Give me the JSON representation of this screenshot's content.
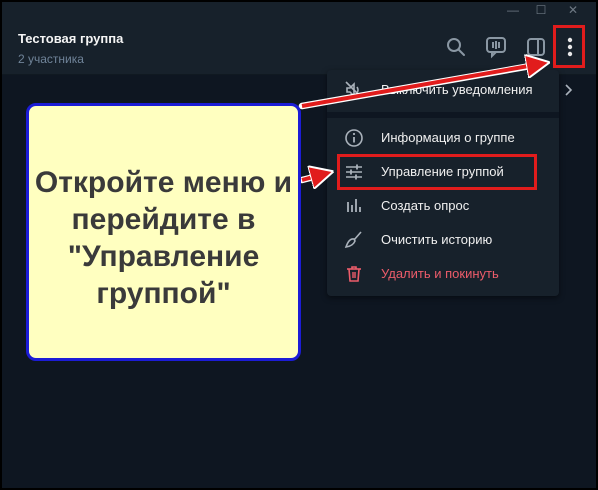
{
  "chat": {
    "title": "Тестовая группа",
    "subtitle": "2 участника"
  },
  "window": {
    "minimize": "—",
    "maximize": "☐",
    "close": "✕"
  },
  "menu": {
    "items": [
      {
        "label": "Выключить уведомления",
        "icon": "mute-icon"
      },
      {
        "label": "Информация о группе",
        "icon": "info-icon"
      },
      {
        "label": "Управление группой",
        "icon": "sliders-icon"
      },
      {
        "label": "Создать опрос",
        "icon": "poll-icon"
      },
      {
        "label": "Очистить историю",
        "icon": "broom-icon"
      },
      {
        "label": "Удалить и покинуть",
        "icon": "trash-icon"
      }
    ]
  },
  "callout": {
    "text": "Откройте меню и перейдите в \"Управление группой\""
  },
  "colors": {
    "accent_red": "#e11c1c",
    "callout_bg": "#ffffc0",
    "callout_border": "#1c1cd6",
    "danger": "#ec5c6a"
  }
}
